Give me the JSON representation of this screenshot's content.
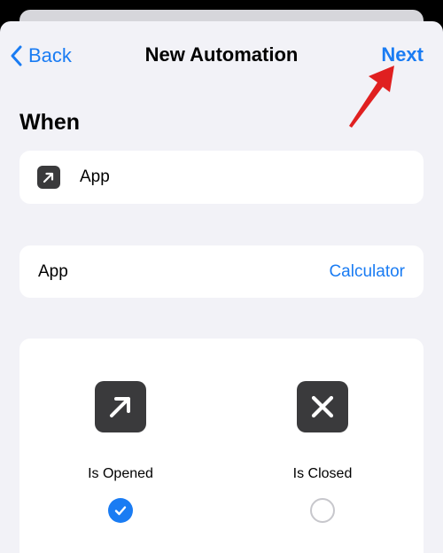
{
  "nav": {
    "back_label": "Back",
    "title": "New Automation",
    "next_label": "Next"
  },
  "section": {
    "title": "When"
  },
  "trigger": {
    "icon": "arrow-up-right-icon",
    "label": "App"
  },
  "app_setting": {
    "label": "App",
    "value": "Calculator"
  },
  "options": [
    {
      "label": "Is Opened",
      "icon": "arrow-up-right-icon",
      "selected": true
    },
    {
      "label": "Is Closed",
      "icon": "x-mark-icon",
      "selected": false
    }
  ],
  "colors": {
    "accent": "#1a7cf3",
    "annotation_arrow": "#e02020",
    "icon_tile": "#3a3a3c",
    "background": "#f2f2f7"
  }
}
